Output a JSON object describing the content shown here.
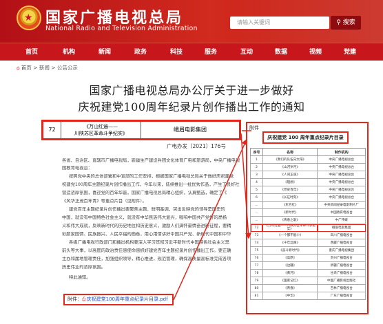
{
  "header": {
    "title_cn": "国家广播电视总局",
    "title_en": "National Radio and Television Administration",
    "emblem_icon": "national-emblem-icon",
    "search_placeholder": "请输入关键词",
    "search_button": "搜索",
    "brand_color": "#c8161d"
  },
  "nav": {
    "items": [
      "首页",
      "机构",
      "新闻",
      "政务",
      "科技",
      "服务",
      "互动",
      "数据",
      "视频",
      "党建"
    ]
  },
  "breadcrumb": {
    "home": "首页",
    "sep": ">",
    "news": "新闻",
    "notice": "公告公示"
  },
  "article": {
    "title_line1": "国家广播电视总局办公厅关于进一步做好",
    "title_line2": "庆祝建党100周年纪录片创作播出工作的通知",
    "doc_number": "广电办发〔2021〕176号",
    "highlight_row": {
      "no": "72",
      "work_line1": "《万山红遍——",
      "work_line2": "川陕苏区革命斗争纪实》",
      "producer": "峨眉电影集团"
    },
    "body": [
      "各省、自治区、直辖市广播电视局，新疆生产建设兵团文化体育广电和旅游局，中央广播电视总台，",
      "国教育电视台：",
      "按照党中央的总体部署和中宣部的工作安排，根据国家广播电视总局关于做好庆祝建党",
      "祝建党100周年主题纪录片创作播出工作，今年以来，陆续推出一批优秀作品，产生了良好社",
      "营造浓厚氛围，喜迎党的百年华诞，国家广播电视总局精心组织，认真甄选，确定了《",
      "《风华正茂百年青》等重点片目（见附件）。",
      "建党百年主题纪录片创作播出要聚焦主题、鲜明基调，突出反映党的领导是历史的",
      "中国，就没有中国特色社会主义，就没有中华民族伟大复兴，唱响中国共产党好的昂扬",
      "义和伟大成就，反映新时代的历史地位和历史意义，激励人们满怀豪情奋进新征程，要精",
      "彩颜家国情、民族振兴、人民幸福的画卷，用心用情讲好中国共产党、新时代中国和中华",
      "各级广播电视行政部门和播出机构要深入学习贯彻习近平新时代中国特色社会主义思",
      "前头等大事，以高度的政治责任感使命感抓好建党百年主题纪录片创作播出工作。要正确",
      "主办和属地管理责任，加强组织领导，精心推进，规范管理，确保高质量高标准完成各项",
      "历史伟业的浓厚氛围。",
      "特此通知。"
    ],
    "attachment_label": "附件：",
    "attachment_file": "庆祝建党100周年重点纪录片目录.pdf"
  },
  "panel": {
    "header": "附件",
    "title": "庆祝建党 100 周年重点纪录片目录",
    "columns": [
      "序号",
      "名称",
      "制作机构"
    ],
    "rows": [
      [
        "1",
        "《我们的队伍向太阳》",
        "中央广播电视总台"
      ],
      [
        "2",
        "《山河岁月》",
        "中央广播电视总台"
      ],
      [
        "3",
        "《人间正道》",
        "中央广播电视总台"
      ],
      [
        "4",
        "《理想》",
        "中央广播电视总台"
      ],
      [
        "5",
        "《党史百年》",
        "中央广播电视总台"
      ],
      [
        "6",
        "《长征时刻》",
        "中央广播电视总台"
      ],
      [
        "...",
        "《东方红》",
        "中央新闻纪录电影制片厂"
      ],
      [
        "...",
        "《新时代》",
        "中国教育电视台"
      ],
      [
        "...",
        "《青春之歌》",
        "中广传媒"
      ],
      [
        "72",
        "《万山红遍——川陕苏区革命斗争纪实》",
        "峨眉电影集团"
      ],
      [
        "73",
        "《一个都不能少》",
        "四川广播电视台"
      ],
      [
        "74",
        "《千年丝路》",
        "西藏广播电视台"
      ],
      [
        "75",
        "《奋斗新时代》",
        "重庆广播电视集团"
      ],
      [
        "76",
        "《高原》",
        "贵州广播电视台"
      ],
      [
        "77",
        "《边疆》",
        "新疆广播电视台"
      ],
      [
        "78",
        "《黄河》",
        "甘肃广播电视台"
      ],
      [
        "79",
        "《国家记忆》",
        "中国广播影视出版社"
      ],
      [
        "80",
        "《青春》",
        "吉林广播电视台"
      ],
      [
        "81",
        "《中华》",
        "广东广播电视台"
      ]
    ],
    "highlight_index": 9
  }
}
